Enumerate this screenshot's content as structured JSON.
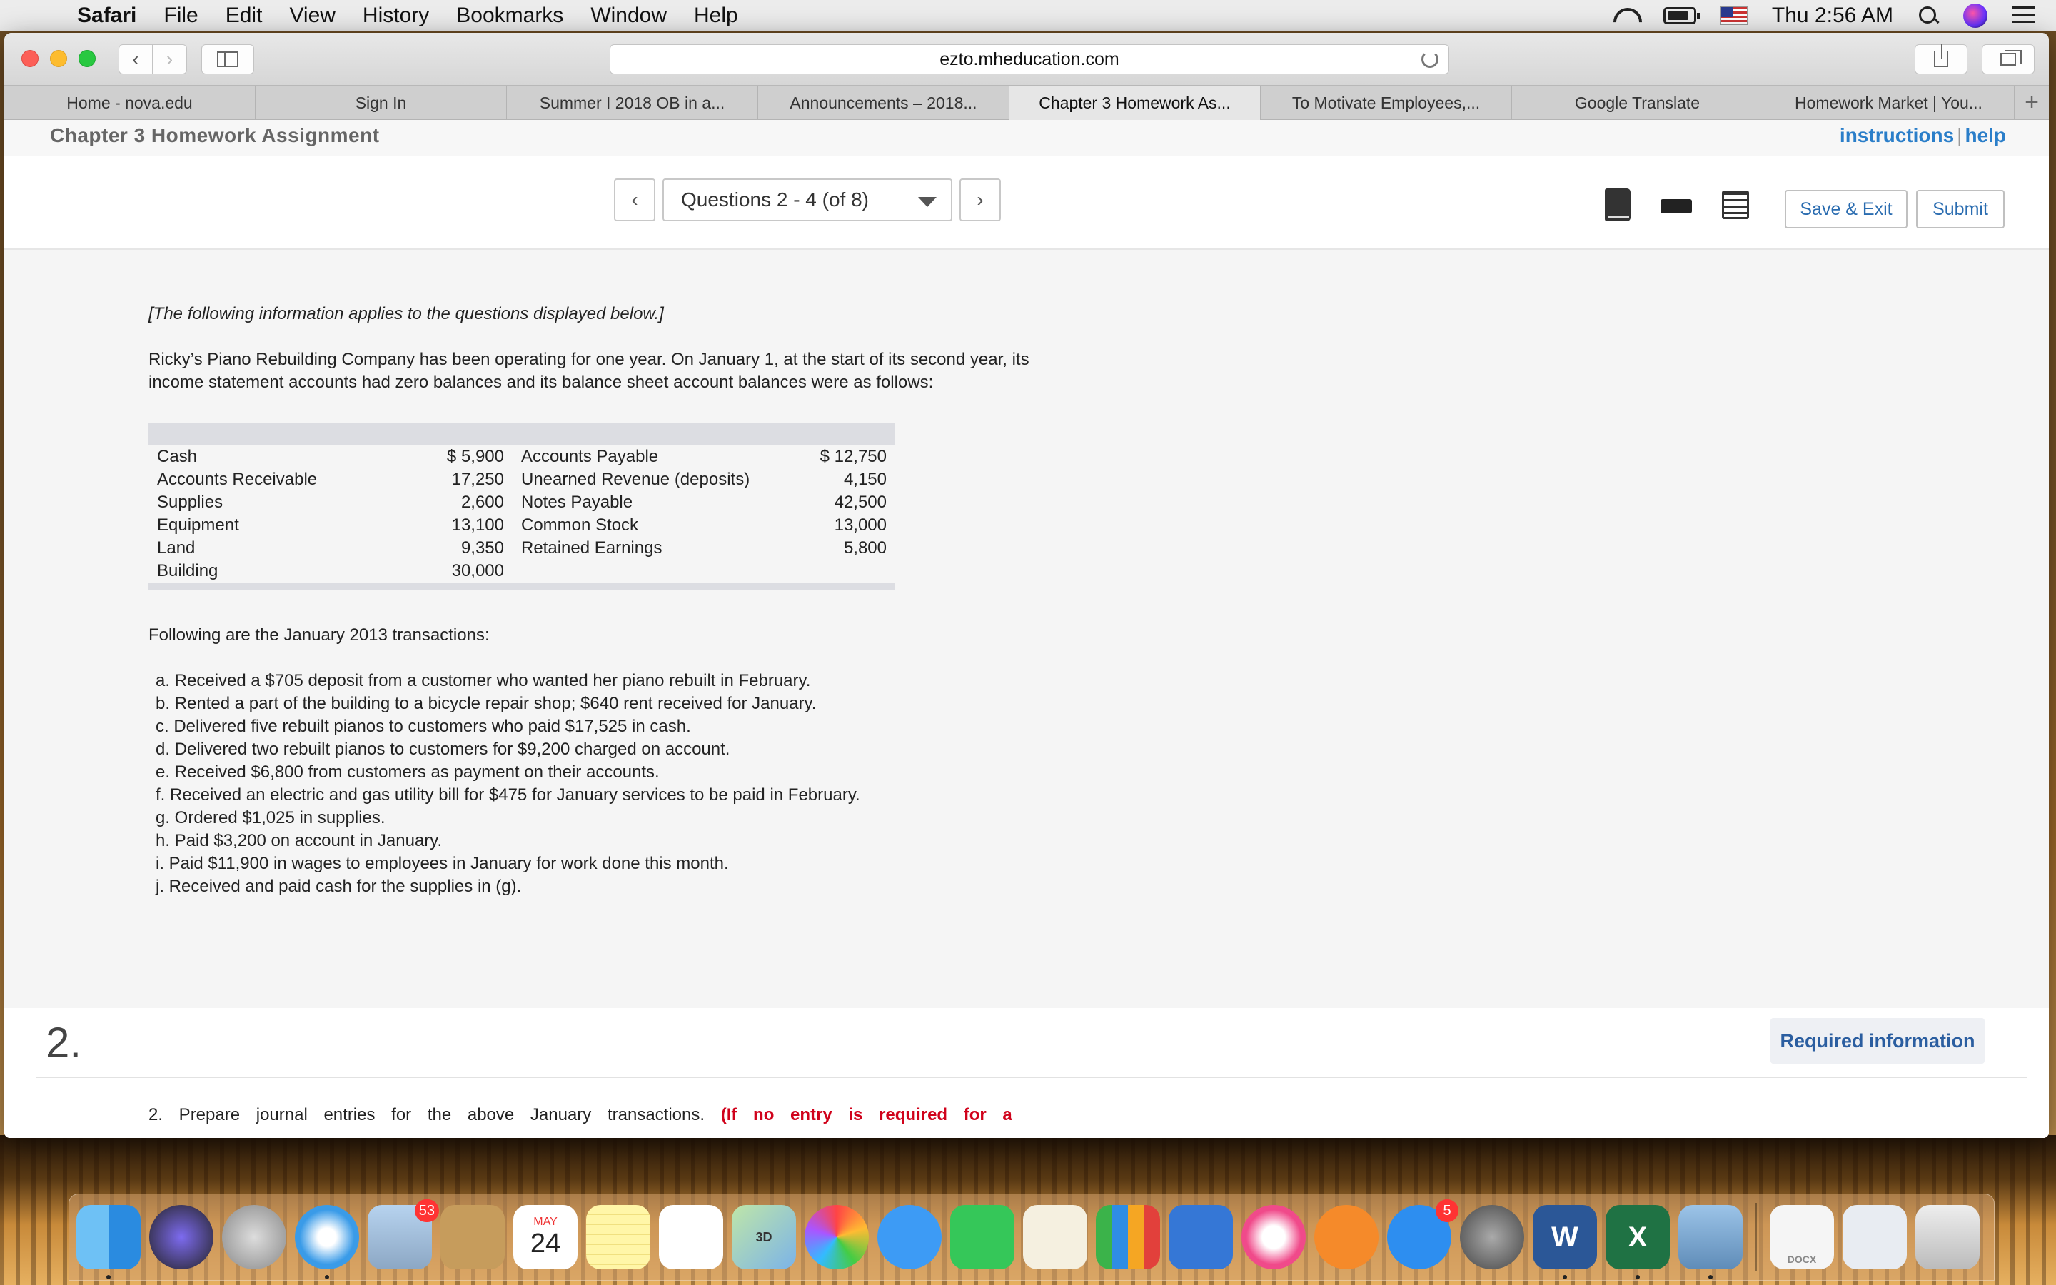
{
  "menubar": {
    "app": "Safari",
    "items": [
      "File",
      "Edit",
      "View",
      "History",
      "Bookmarks",
      "Window",
      "Help"
    ],
    "clock": "Thu 2:56 AM",
    "battery_level": 0.85
  },
  "browser": {
    "url": "ezto.mheducation.com",
    "tabs": [
      {
        "label": "Home - nova.edu"
      },
      {
        "label": "Sign In"
      },
      {
        "label": "Summer I 2018 OB in a..."
      },
      {
        "label": "Announcements – 2018..."
      },
      {
        "label": "Chapter 3 Homework As...",
        "active": true
      },
      {
        "label": "To Motivate Employees,..."
      },
      {
        "label": "Google Translate"
      },
      {
        "label": "Homework Market | You..."
      }
    ],
    "add_tab": "+"
  },
  "page": {
    "assignment_title": "Chapter 3 Homework Assignment",
    "instructions_link": "instructions",
    "help_separator": "|",
    "help_link": "help",
    "question_selector": "Questions 2 - 4 (of 8)",
    "prev_glyph": "‹",
    "next_glyph": "›",
    "save_exit": "Save & Exit",
    "submit": "Submit"
  },
  "info": {
    "note": "[The following information applies to the questions displayed below.]",
    "intro": "Ricky’s Piano Rebuilding Company has been operating for one year. On January 1, at the start of its second year, its income statement accounts had zero balances and its balance sheet account balances were as follows:",
    "balances": [
      {
        "left_label": "Cash",
        "left_value": "$ 5,900",
        "right_label": "Accounts Payable",
        "right_value": "$ 12,750"
      },
      {
        "left_label": "Accounts Receivable",
        "left_value": "17,250",
        "right_label": "Unearned Revenue (deposits)",
        "right_value": "4,150"
      },
      {
        "left_label": "Supplies",
        "left_value": "2,600",
        "right_label": "Notes Payable",
        "right_value": "42,500"
      },
      {
        "left_label": "Equipment",
        "left_value": "13,100",
        "right_label": "Common Stock",
        "right_value": "13,000"
      },
      {
        "left_label": "Land",
        "left_value": "9,350",
        "right_label": "Retained Earnings",
        "right_value": "5,800"
      },
      {
        "left_label": "Building",
        "left_value": "30,000",
        "right_label": "",
        "right_value": ""
      }
    ],
    "transactions_intro": "Following are the January 2013 transactions:",
    "transactions": [
      "a. Received a $705 deposit from a customer who wanted her piano rebuilt in February.",
      "b. Rented a part of the building to a bicycle repair shop; $640 rent received for January.",
      "c. Delivered five rebuilt pianos to customers who paid $17,525 in cash.",
      "d. Delivered two rebuilt pianos to customers for $9,200 charged on account.",
      "e. Received $6,800 from customers as payment on their accounts.",
      "f. Received an electric and gas utility bill for $475 for January services to be paid in February.",
      "g. Ordered $1,025 in supplies.",
      "h. Paid $3,200 on account in January.",
      "i. Paid $11,900 in wages to employees in January for work done this month.",
      "j. Received and paid cash for the supplies in (g)."
    ]
  },
  "question": {
    "number": "2.",
    "required_info": "Required information",
    "prompt_start": "2. Prepare journal entries for the above January transactions.",
    "prompt_red": "(If no entry is required for a"
  },
  "dock": {
    "mail_badge": "53",
    "calendar_month": "MAY",
    "calendar_day": "24",
    "appstore_badge": "5",
    "word_letter": "W",
    "excel_letter": "X",
    "maps_label": "3D",
    "docx_label": "DOCX"
  }
}
